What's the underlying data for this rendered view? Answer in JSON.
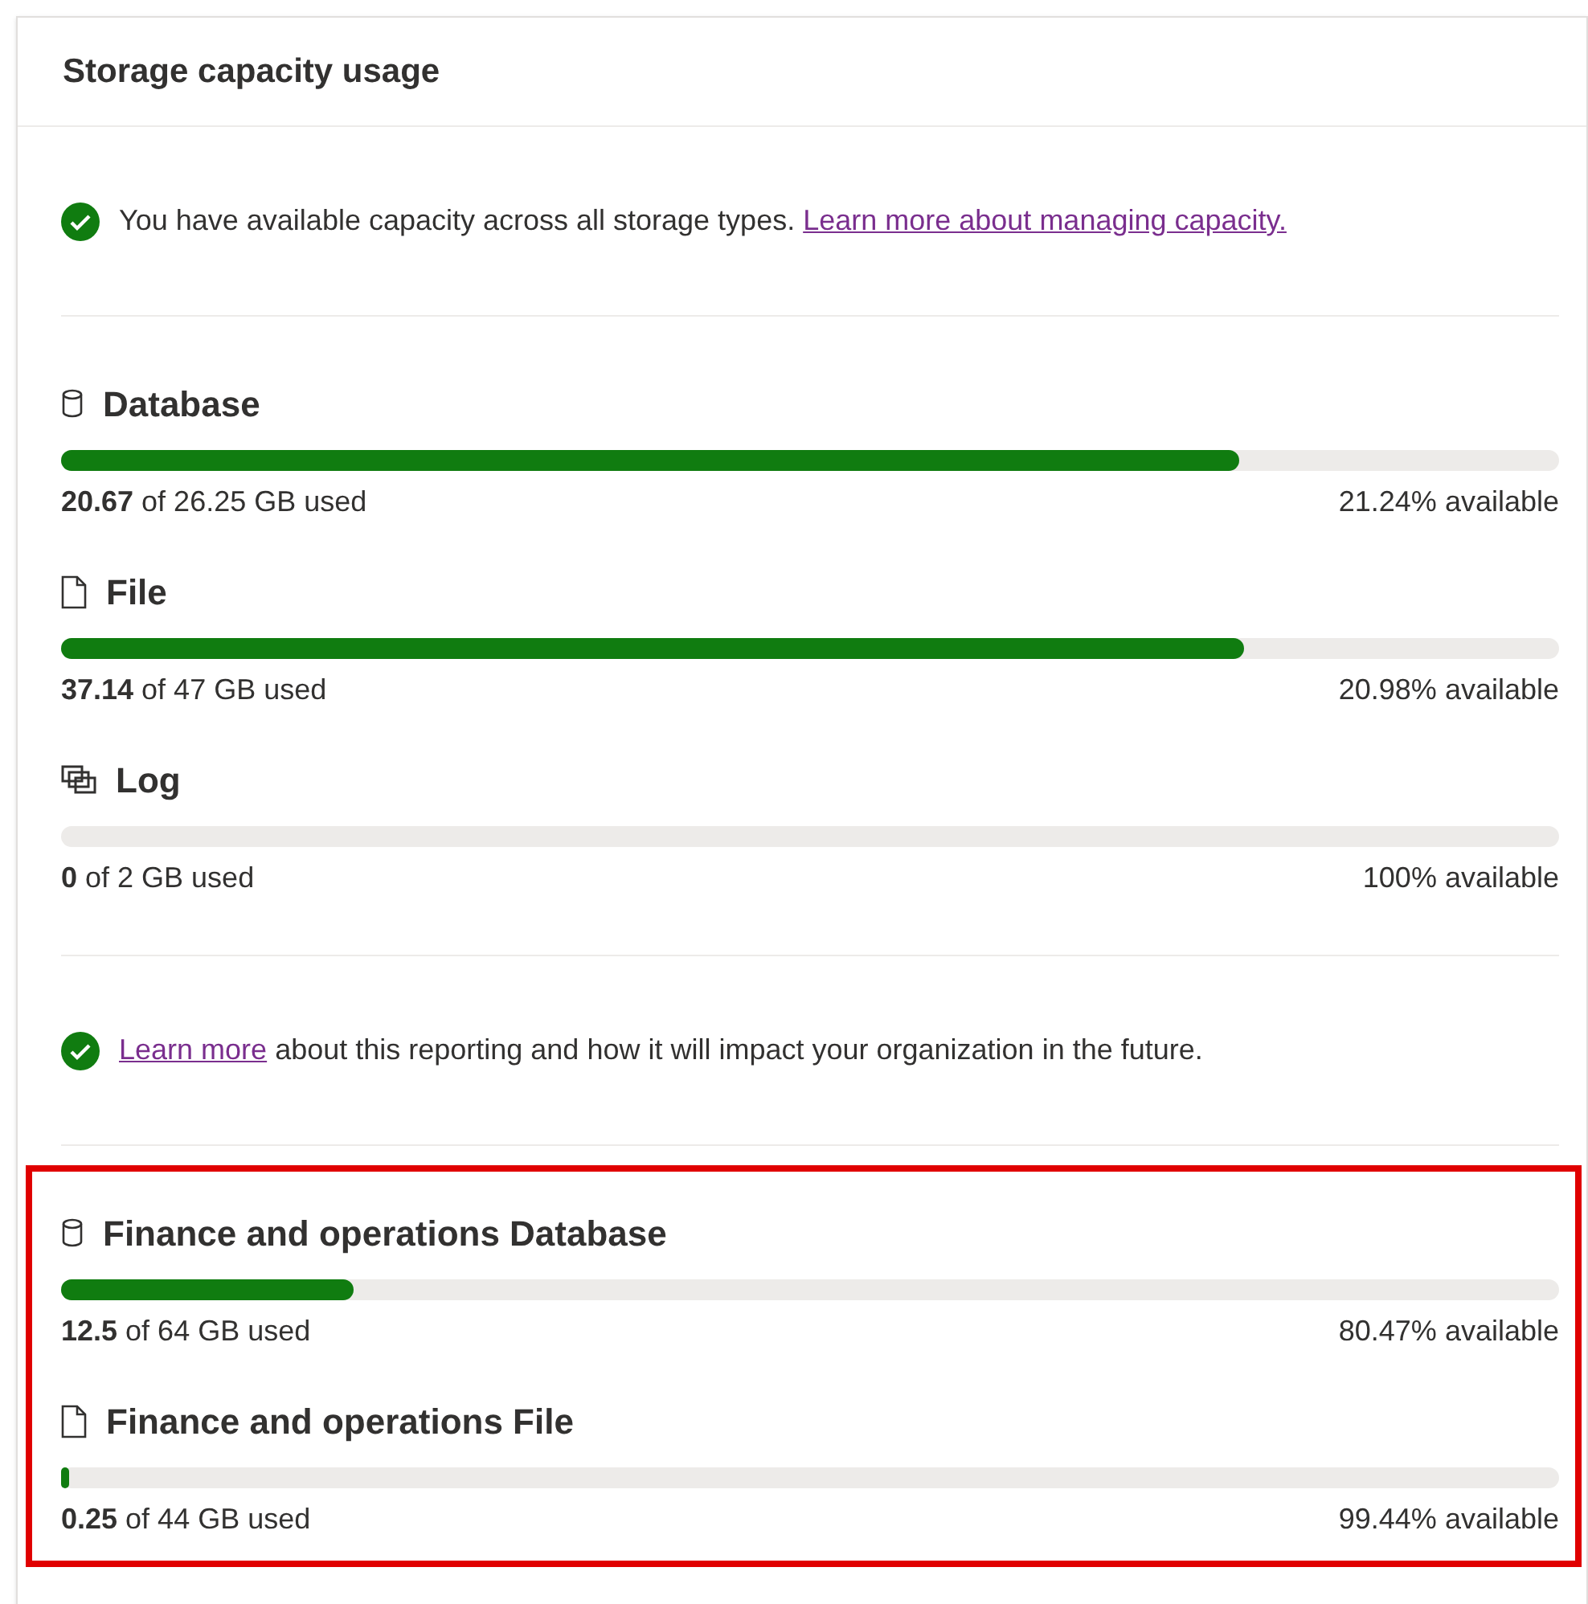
{
  "title": "Storage capacity usage",
  "blocks": [
    {
      "kind": "notice",
      "before": "You have available capacity across all storage types.",
      "link": "Learn more about managing capacity."
    },
    {
      "kind": "meters",
      "meters": [
        {
          "kind": "database",
          "name": "Database",
          "used": "**20.67** of 26.25 GB used",
          "available": "21.24% available",
          "level": 0.787
        },
        {
          "kind": "file",
          "name": "File",
          "used": "**37.14** of 47 GB used",
          "available": "20.98% available",
          "level": 0.79
        },
        {
          "kind": "log",
          "name": "Log",
          "used": "**0** of 2 GB used",
          "available": "100% available",
          "level": 0
        }
      ]
    },
    {
      "kind": "notice",
      "link": "Learn more",
      "after": "about this reporting and how it will impact your organization in the future."
    },
    {
      "kind": "framed_meters",
      "meters": [
        {
          "kind": "database",
          "name": "Finance and operations Database",
          "used": "**12.5** of 64 GB used",
          "available": "80.47% available",
          "level": 0.195
        },
        {
          "kind": "file",
          "name": "Finance and operations File",
          "used": "**0.25** of 44 GB used",
          "available": "99.44% available",
          "level": 0.005
        }
      ]
    }
  ]
}
